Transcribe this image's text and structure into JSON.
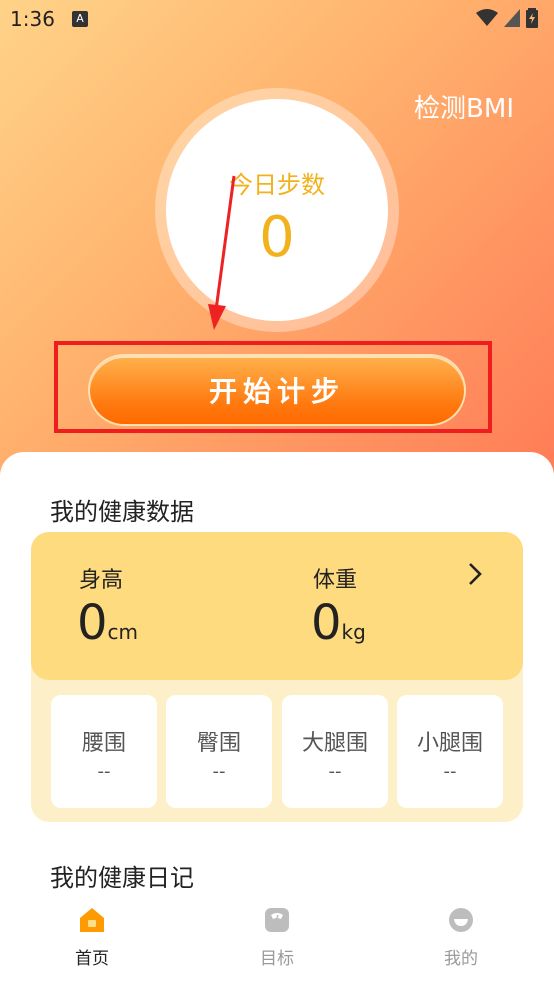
{
  "status_bar": {
    "time": "1:36",
    "notification_glyph": "A"
  },
  "header": {
    "bmi_link": "检测BMI"
  },
  "step_counter": {
    "label": "今日步数",
    "value": "0"
  },
  "start_button": "开始计步",
  "health_data": {
    "title": "我的健康数据",
    "height": {
      "label": "身高",
      "value": "0",
      "unit": "cm"
    },
    "weight": {
      "label": "体重",
      "value": "0",
      "unit": "kg"
    },
    "measurements": [
      {
        "label": "腰围",
        "value": "--"
      },
      {
        "label": "臀围",
        "value": "--"
      },
      {
        "label": "大腿围",
        "value": "--"
      },
      {
        "label": "小腿围",
        "value": "--"
      }
    ]
  },
  "diary": {
    "title": "我的健康日记"
  },
  "tabs": [
    {
      "label": "首页",
      "icon": "home-icon",
      "active": true
    },
    {
      "label": "目标",
      "icon": "scale-icon",
      "active": false
    },
    {
      "label": "我的",
      "icon": "profile-icon",
      "active": false
    }
  ],
  "colors": {
    "accent": "#f2b21d",
    "button": "#ff7a10",
    "highlight": "#ee1e1e",
    "card": "#fedb7f",
    "tab_active": "#ff9a00",
    "tab_inactive": "#bdbdbd"
  }
}
